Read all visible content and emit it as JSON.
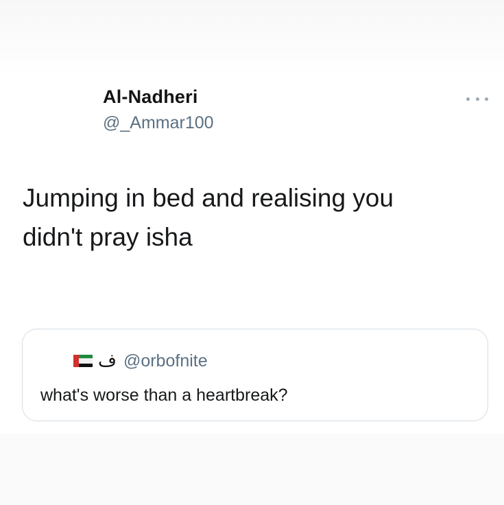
{
  "tweet": {
    "display_name": "Al-Nadheri",
    "handle": "@_Ammar100",
    "more_icon": "more-horizontal-icon",
    "text_lines": [
      "Jumping in bed and realising you",
      "didn't pray isha"
    ]
  },
  "quoted_tweet": {
    "flag_icon": "uae-flag-icon",
    "display_name": "ف",
    "handle": "@orbofnite",
    "text": "what's worse than a heartbreak?"
  },
  "colors": {
    "text": "#16181a",
    "secondary": "#5b7083",
    "border": "#d6dde3"
  }
}
